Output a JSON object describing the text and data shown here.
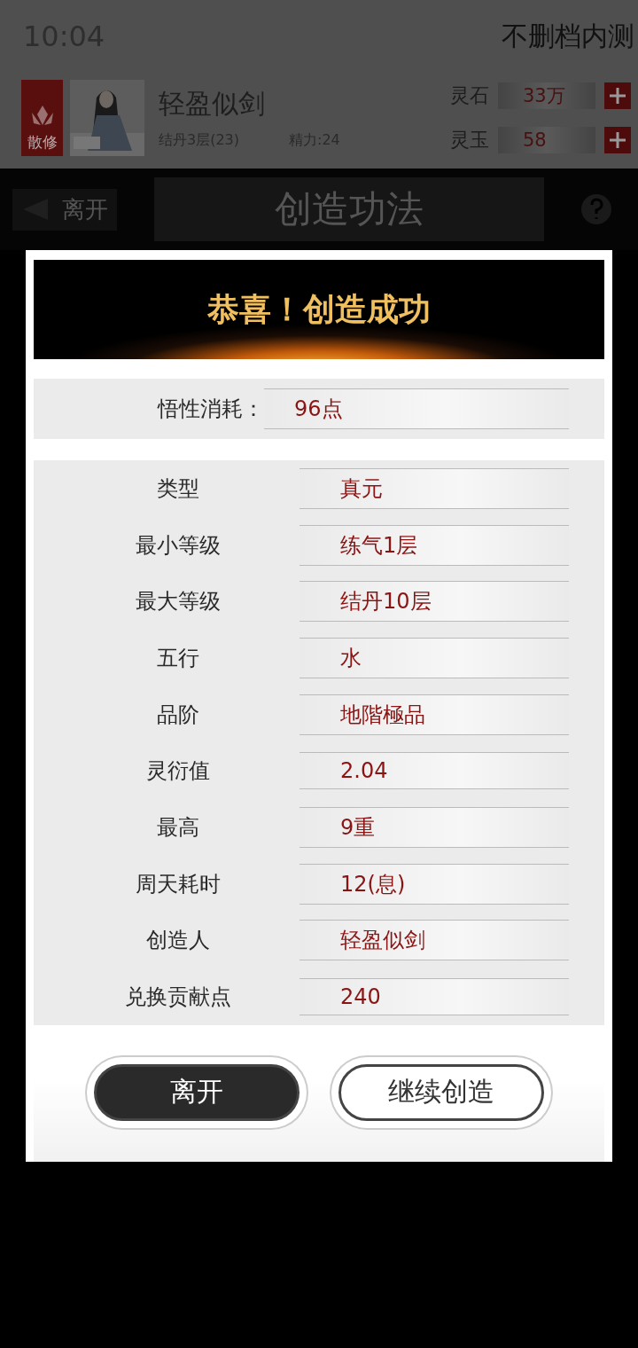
{
  "status_bar": {
    "time": "10:04",
    "server": "不删档内测"
  },
  "player": {
    "sect_badge": "散修",
    "name": "轻盈似剑",
    "realm": "结丹3层(23)",
    "energy": "精力:24",
    "currencies": [
      {
        "label": "灵石",
        "value": "33万"
      },
      {
        "label": "灵玉",
        "value": "58"
      }
    ]
  },
  "nav": {
    "back": "离开",
    "title": "创造功法"
  },
  "dialog": {
    "banner": "恭喜！创造成功",
    "cost": {
      "label": "悟性消耗：",
      "value": "96点"
    },
    "attributes": [
      {
        "label": "类型",
        "value": "真元"
      },
      {
        "label": "最小等级",
        "value": "练气1层"
      },
      {
        "label": "最大等级",
        "value": "结丹10层"
      },
      {
        "label": "五行",
        "value": "水"
      },
      {
        "label": "品阶",
        "value": "地階極品"
      },
      {
        "label": "灵衍值",
        "value": "2.04"
      },
      {
        "label": "最高",
        "value": "9重"
      },
      {
        "label": "周天耗时",
        "value": "12(息)"
      },
      {
        "label": "创造人",
        "value": "轻盈似剑"
      },
      {
        "label": "兑换贡献点",
        "value": "240"
      }
    ],
    "buttons": [
      {
        "label": "离开",
        "kind": "dark"
      },
      {
        "label": "继续创造",
        "kind": "light"
      }
    ]
  }
}
